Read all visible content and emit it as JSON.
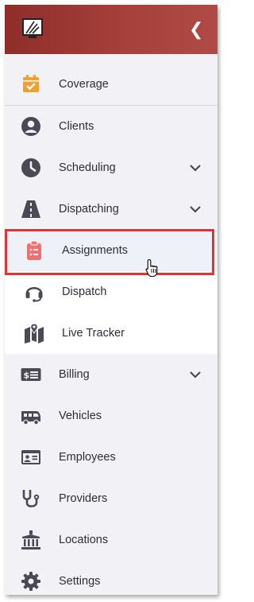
{
  "sidebar": {
    "collapse_glyph": "❮",
    "items": [
      {
        "key": "coverage",
        "label": "Coverage",
        "icon": "calendar-check-icon"
      },
      {
        "key": "clients",
        "label": "Clients",
        "icon": "user-circle-icon"
      },
      {
        "key": "scheduling",
        "label": "Scheduling",
        "icon": "clock-icon"
      },
      {
        "key": "dispatching",
        "label": "Dispatching",
        "icon": "road-icon"
      },
      {
        "key": "assignments",
        "label": "Assignments",
        "icon": "clipboard-list-icon"
      },
      {
        "key": "dispatch",
        "label": "Dispatch",
        "icon": "headset-icon"
      },
      {
        "key": "live-tracker",
        "label": "Live Tracker",
        "icon": "map-marker-icon"
      },
      {
        "key": "billing",
        "label": "Billing",
        "icon": "money-bill-icon"
      },
      {
        "key": "vehicles",
        "label": "Vehicles",
        "icon": "van-icon"
      },
      {
        "key": "employees",
        "label": "Employees",
        "icon": "id-card-icon"
      },
      {
        "key": "providers",
        "label": "Providers",
        "icon": "stethoscope-icon"
      },
      {
        "key": "locations",
        "label": "Locations",
        "icon": "building-columns-icon"
      },
      {
        "key": "settings",
        "label": "Settings",
        "icon": "gear-icon"
      }
    ]
  },
  "colors": {
    "header": "#a6403b",
    "icon": "#4a4a56",
    "coverage_icon": "#f0a030",
    "assignments_icon": "#f07070",
    "highlight_border": "#e03333"
  }
}
